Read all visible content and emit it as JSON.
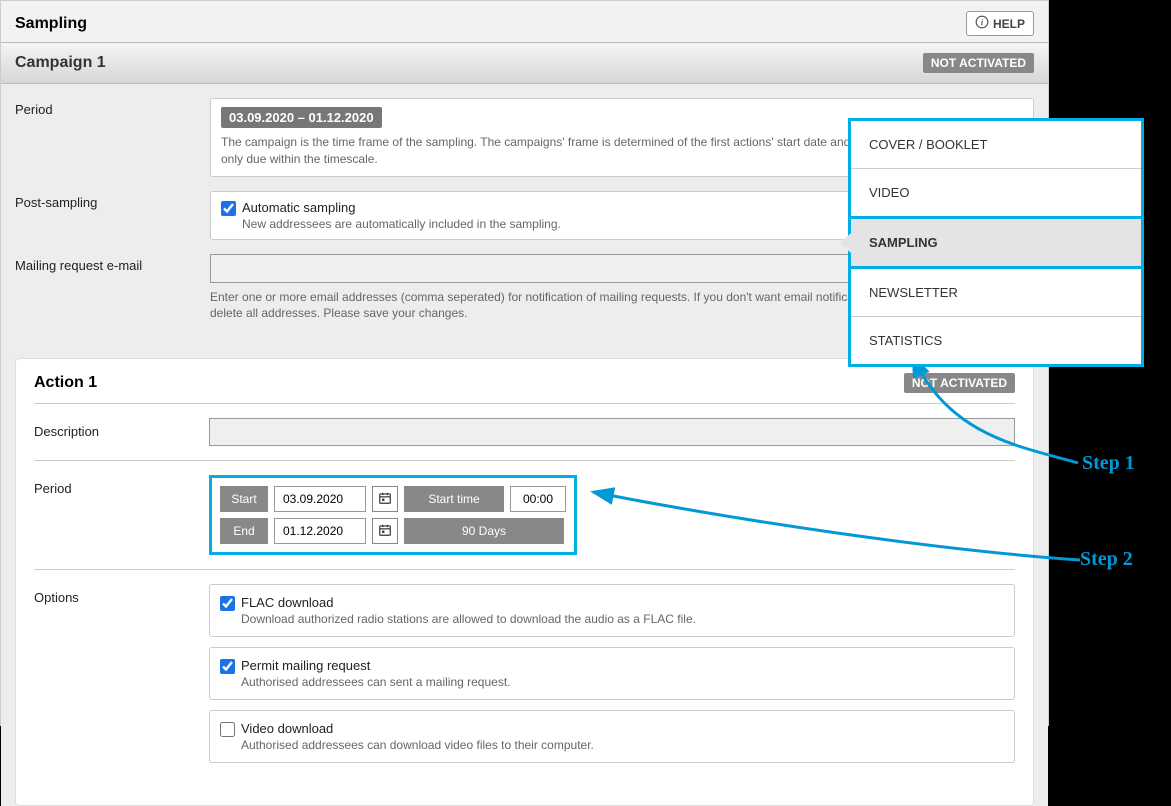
{
  "header": {
    "title": "Sampling",
    "help_label": "HELP"
  },
  "nav": {
    "items": [
      {
        "label": "COVER / BOOKLET"
      },
      {
        "label": "VIDEO"
      },
      {
        "label": "SAMPLING",
        "active": true
      },
      {
        "label": "NEWSLETTER"
      },
      {
        "label": "STATISTICS"
      }
    ]
  },
  "campaign": {
    "title": "Campaign 1",
    "status": "NOT ACTIVATED",
    "period_label": "Period",
    "date_range": "03.09.2020 – 01.12.2020",
    "period_help": "The campaign is the time frame of the sampling. The campaigns' frame is determined of the first actions' start date and end date. All following actions only due within the timescale.",
    "post_sampling_label": "Post-sampling",
    "auto_sampling_label": "Automatic sampling",
    "auto_sampling_desc": "New addressees are automatically included in the sampling.",
    "mailing_label": "Mailing request e-mail",
    "mailing_value": "",
    "mailing_help": "Enter one or more email addresses (comma seperated) for notification of mailing requests. If you don't want email notifications leave the field empty and delete all addresses. Please save your changes."
  },
  "action": {
    "title": "Action 1",
    "status": "NOT ACTIVATED",
    "description_label": "Description",
    "description_value": "",
    "period_label": "Period",
    "start_label": "Start",
    "start_date": "03.09.2020",
    "start_time_label": "Start time",
    "start_time": "00:00",
    "end_label": "End",
    "end_date": "01.12.2020",
    "days_label": "90 Days",
    "options_label": "Options",
    "options": [
      {
        "key": "flac",
        "checked": true,
        "label": "FLAC download",
        "desc": "Download authorized radio stations are allowed to download the audio as a FLAC file."
      },
      {
        "key": "permit",
        "checked": true,
        "label": "Permit mailing request",
        "desc": "Authorised addressees can sent a mailing request."
      },
      {
        "key": "video",
        "checked": false,
        "label": "Video download",
        "desc": "Authorised addressees can download video files to their computer."
      }
    ]
  },
  "annotations": {
    "step1": "Step 1",
    "step2": "Step 2"
  }
}
